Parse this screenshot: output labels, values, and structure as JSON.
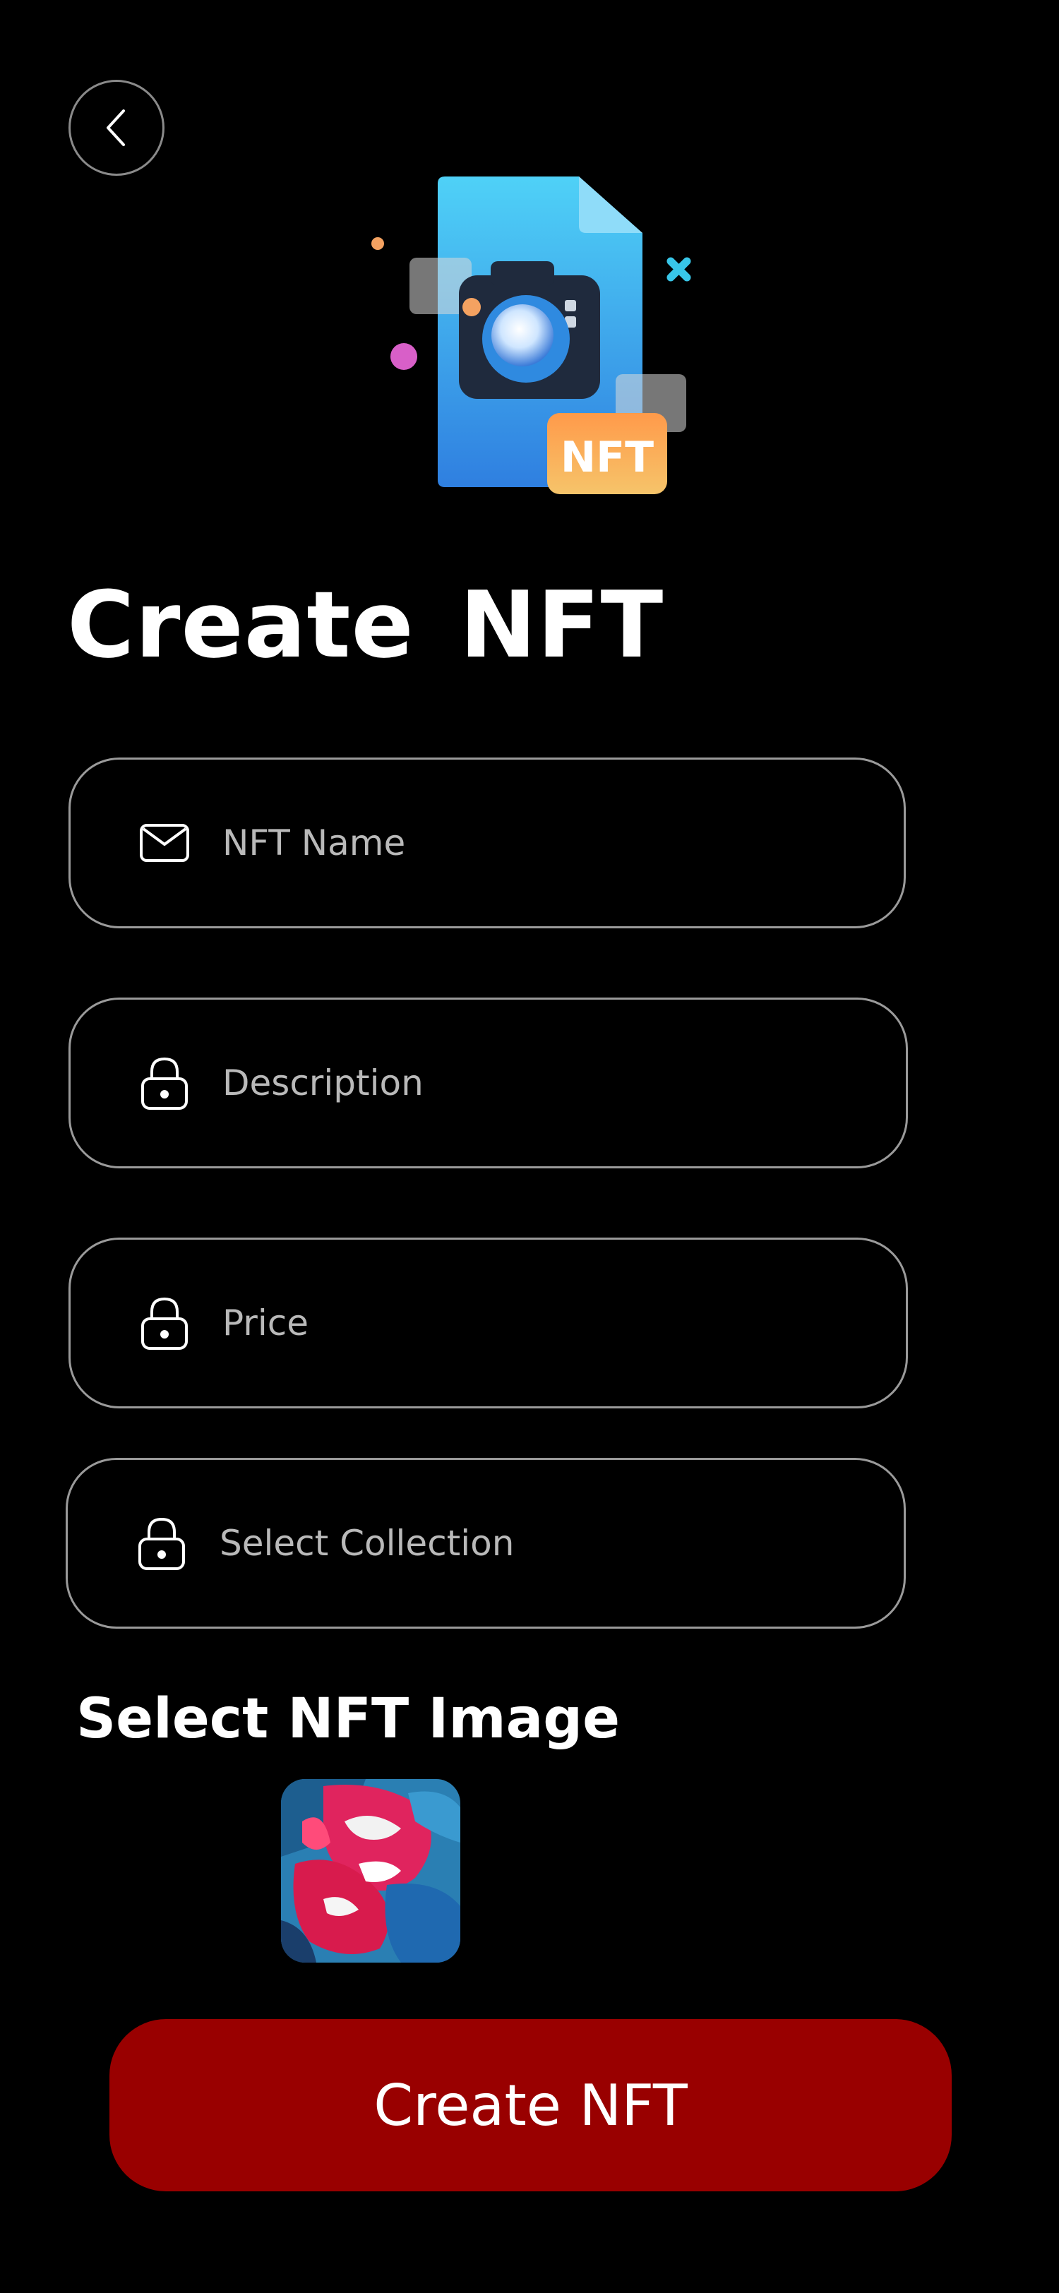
{
  "header": {
    "back_icon": "chevron-left-icon"
  },
  "hero": {
    "illustration": "camera-file-nft-illustration",
    "badge_text": "NFT"
  },
  "page": {
    "title": "Create NFT"
  },
  "form": {
    "fields": [
      {
        "placeholder": "NFT Name",
        "icon": "mail-icon"
      },
      {
        "placeholder": "Description",
        "icon": "lock-icon"
      },
      {
        "placeholder": "Price",
        "icon": "lock-icon"
      },
      {
        "placeholder": "Select Collection",
        "icon": "lock-icon"
      }
    ],
    "image_section_label": "Select NFT Image",
    "selected_image": "abstract-painting-thumbnail"
  },
  "actions": {
    "submit_label": "Create NFT"
  },
  "colors": {
    "background": "#000000",
    "field_border": "#9a9a9a",
    "placeholder_text": "#b9b9b9",
    "primary_button": "#990000",
    "text": "#ffffff"
  }
}
